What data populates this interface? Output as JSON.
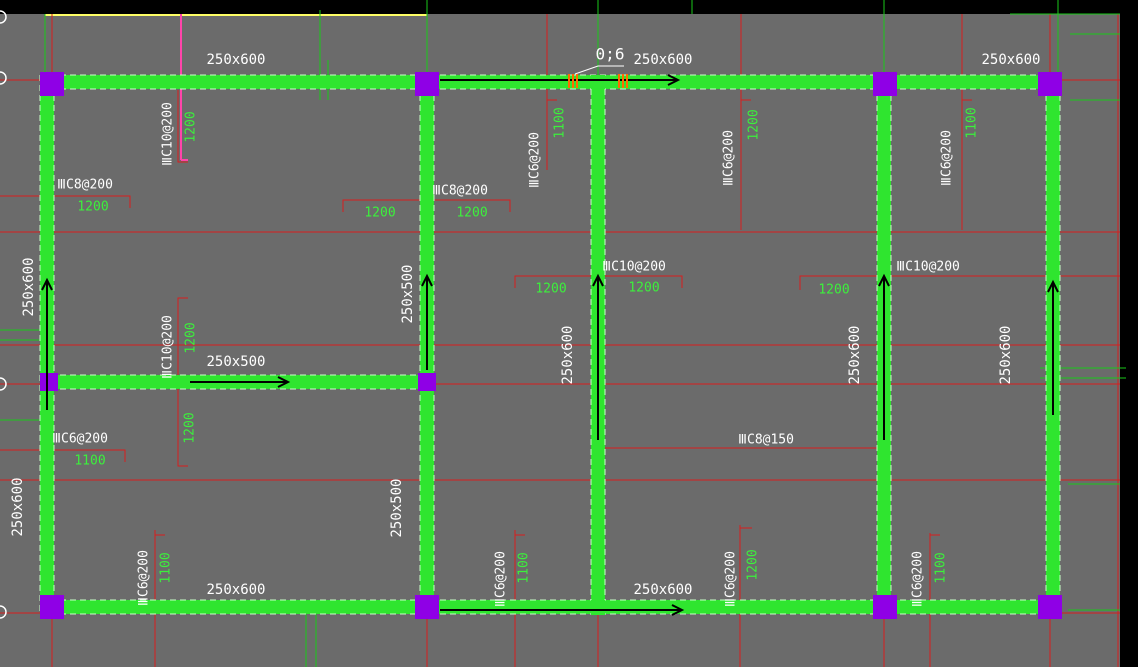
{
  "colors": {
    "background": "#6b6b6b",
    "beam": "#2fe52f",
    "beam_dash": "#c8ffc8",
    "column": "#8f00e6",
    "axis": "#d81e1e",
    "green_line": "#1ac81a",
    "white_text": "#ffffff",
    "green_text": "#3cf03c",
    "arrow": "#000000",
    "top_edge": "#ffff66"
  },
  "annotations": {
    "top_mark": "0;6",
    "beam_labels": [
      "250x600",
      "250x600",
      "250x600",
      "250x600",
      "250x600",
      "250x500",
      "250x500",
      "250x500",
      "250x600",
      "250x600",
      "250x600",
      "250x600",
      "250x600"
    ],
    "rebar_labels": [
      "ⅢC10@200",
      "ⅢC6@200",
      "ⅢC6@200",
      "ⅢC6@200",
      "ⅢC8@200",
      "ⅢC8@200",
      "ⅢC10@200",
      "ⅢC10@200",
      "ⅢC10@200",
      "ⅢC6@200",
      "ⅢC8@150",
      "ⅢC6@200",
      "ⅢC6@200",
      "ⅢC6@200",
      "ⅢC6@200"
    ],
    "length_labels": [
      "1200",
      "1100",
      "1200",
      "1100",
      "1200",
      "1200",
      "1200",
      "1200",
      "1200",
      "1200",
      "1200",
      "1200",
      "1100",
      "1100",
      "1100",
      "1200",
      "1100"
    ]
  }
}
